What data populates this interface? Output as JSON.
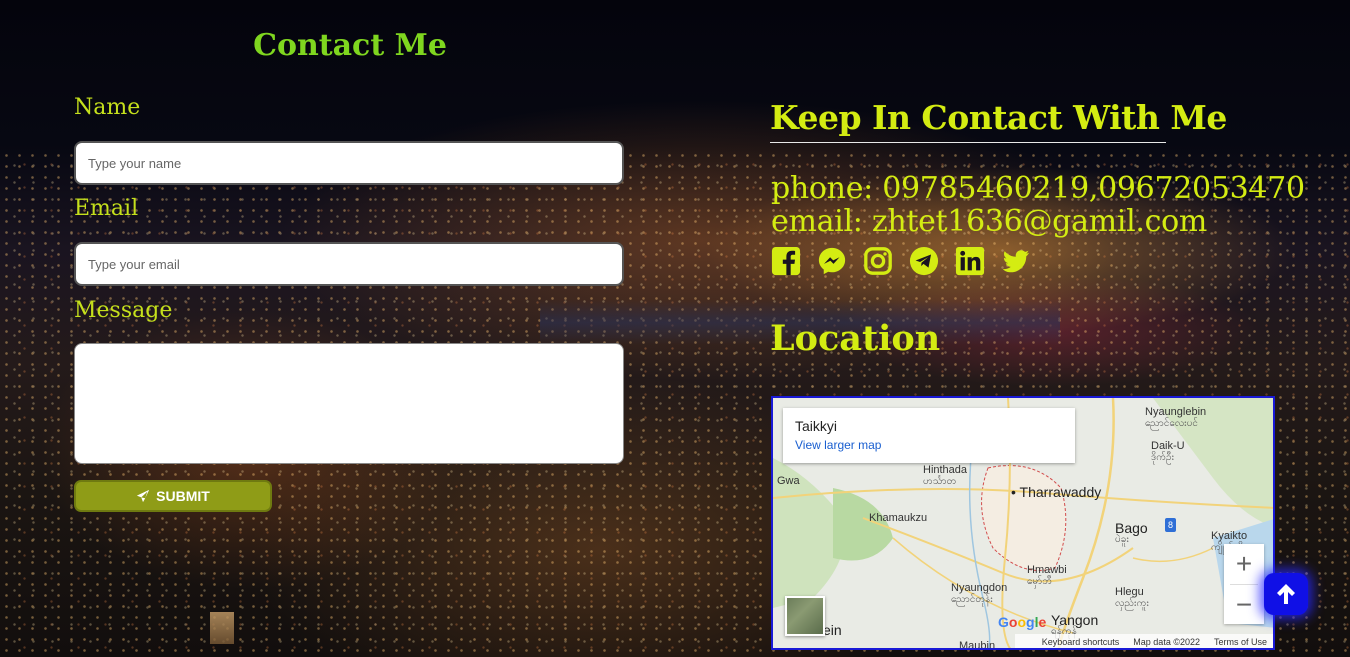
{
  "form": {
    "title": "Contact Me",
    "name_label": "Name",
    "name_placeholder": "Type your name",
    "email_label": "Email",
    "email_placeholder": "Type your email",
    "message_label": "Message",
    "submit_label": "SUBMIT"
  },
  "contact": {
    "title": "Keep In Contact With Me",
    "phone": "phone: 09785460219,09672053470",
    "email": "email: zhtet1636@gamil.com",
    "social_icons": [
      "facebook-icon",
      "messenger-icon",
      "instagram-icon",
      "telegram-icon",
      "linkedin-icon",
      "twitter-icon"
    ]
  },
  "location": {
    "title": "Location",
    "map": {
      "place": "Taikkyi",
      "larger_map_link": "View larger map",
      "towns": [
        {
          "name": "Nyaunglebin",
          "sub": "ညောင်လေးပင်"
        },
        {
          "name": "Daik-U",
          "sub": "ဒိုက်ဦး"
        },
        {
          "name": "Hinthada",
          "sub": "ဟင်္သာတ"
        },
        {
          "name": "Gwa",
          "sub": ""
        },
        {
          "name": "Tharrawaddy",
          "sub": ""
        },
        {
          "name": "Khamaukzu",
          "sub": ""
        },
        {
          "name": "Bago",
          "sub": "ပဲခူး"
        },
        {
          "name": "Kyaikto",
          "sub": "ကျိုက်ထို"
        },
        {
          "name": "Hmawbi",
          "sub": "မှော်ဘီ"
        },
        {
          "name": "Nyaungdon",
          "sub": "ညောင်တုန်း"
        },
        {
          "name": "Hlegu",
          "sub": "လှည်းကူး"
        },
        {
          "name": "Yangon",
          "sub": "ရန်ကုန်"
        },
        {
          "name": "ein",
          "sub": ""
        },
        {
          "name": "Maubin",
          "sub": ""
        }
      ],
      "road_badge": "8",
      "zoom_in": "+",
      "zoom_out": "−",
      "google": "Google",
      "keyboard_shortcuts": "Keyboard shortcuts",
      "map_data": "Map data ©2022",
      "terms": "Terms of Use"
    }
  },
  "colors": {
    "contact_title": "#7fd61f",
    "accent_yellow": "#d4ec12",
    "submit_bg": "#8f9c17",
    "scroll_top_bg": "#1010e6"
  },
  "scroll_top": {
    "icon": "arrow-up-icon"
  }
}
